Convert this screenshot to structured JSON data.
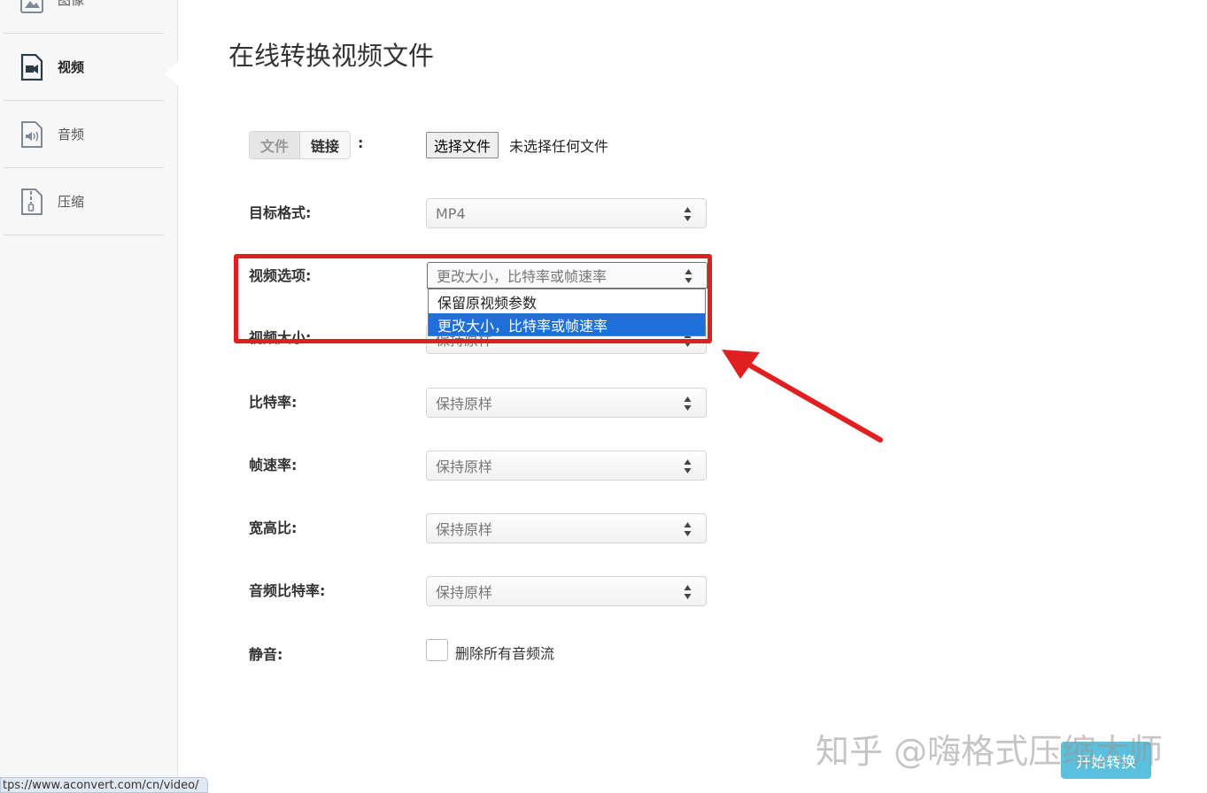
{
  "sidebar": {
    "items": [
      {
        "label": "图像",
        "icon": "image-icon"
      },
      {
        "label": "视频",
        "icon": "video-file-icon",
        "active": true
      },
      {
        "label": "音频",
        "icon": "audio-file-icon"
      },
      {
        "label": "压缩",
        "icon": "zip-file-icon"
      }
    ]
  },
  "page": {
    "title": "在线转换视频文件"
  },
  "source": {
    "tab_file": "文件",
    "tab_link": "链接",
    "colon": ":",
    "choose_file_label": "选择文件",
    "no_file_text": "未选择任何文件"
  },
  "form": {
    "target_format": {
      "label": "目标格式:",
      "value": "MP4"
    },
    "video_options": {
      "label": "视频选项:",
      "value": "更改大小，比特率或帧速率",
      "options": [
        "保留原视频参数",
        "更改大小，比特率或帧速率"
      ],
      "selected_index": 1
    },
    "video_size": {
      "label": "视频大小:",
      "value": "保持原样"
    },
    "bitrate": {
      "label": "比特率:",
      "value": "保持原样"
    },
    "frame_rate": {
      "label": "帧速率:",
      "value": "保持原样"
    },
    "aspect_ratio": {
      "label": "宽高比:",
      "value": "保持原样"
    },
    "audio_bitrate": {
      "label": "音频比特率:",
      "value": "保持原样"
    },
    "mute": {
      "label": "静音:",
      "checkbox_label": "删除所有音频流",
      "checked": false
    }
  },
  "convert_button": "开始转换",
  "status_url": "tps://www.aconvert.com/cn/video/",
  "watermark": "知乎 @嗨格式压缩大师",
  "colors": {
    "accent": "#5bc0de",
    "highlight": "#e02020",
    "selected_option": "#1e6fd9"
  }
}
